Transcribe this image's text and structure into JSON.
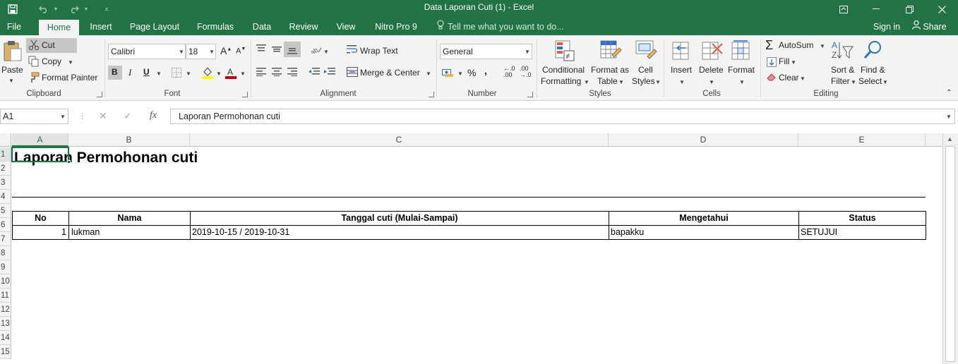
{
  "window": {
    "title": "Data Laporan Cuti (1) - Excel"
  },
  "tabs": [
    "File",
    "Home",
    "Insert",
    "Page Layout",
    "Formulas",
    "Data",
    "Review",
    "View",
    "Nitro Pro 9"
  ],
  "tell_me": "Tell me what you want to do...",
  "account": {
    "sign_in": "Sign in",
    "share": "Share"
  },
  "ribbon": {
    "clipboard": {
      "label": "Clipboard",
      "paste": "Paste",
      "cut": "Cut",
      "copy": "Copy",
      "format_painter": "Format Painter"
    },
    "font": {
      "label": "Font",
      "name": "Calibri",
      "size": "18",
      "bold": "B",
      "italic": "I",
      "underline": "U"
    },
    "alignment": {
      "label": "Alignment",
      "wrap_text": "Wrap Text",
      "merge_center": "Merge & Center"
    },
    "number": {
      "label": "Number",
      "format": "General",
      "percent": "%",
      "comma": ","
    },
    "styles": {
      "label": "Styles",
      "conditional_1": "Conditional",
      "conditional_2": "Formatting",
      "format_table_1": "Format as",
      "format_table_2": "Table",
      "cell_styles_1": "Cell",
      "cell_styles_2": "Styles"
    },
    "cells": {
      "label": "Cells",
      "insert": "Insert",
      "delete": "Delete",
      "format": "Format"
    },
    "editing": {
      "label": "Editing",
      "autosum": "AutoSum",
      "fill": "Fill",
      "clear": "Clear",
      "sort_1": "Sort &",
      "sort_2": "Filter",
      "find_1": "Find &",
      "find_2": "Select"
    }
  },
  "formula_bar": {
    "name_box": "A1",
    "fx": "fx",
    "value": "Laporan Permohonan cuti"
  },
  "sheet": {
    "columns": [
      "A",
      "B",
      "C",
      "D",
      "E"
    ],
    "rows": [
      "1",
      "2",
      "3",
      "4",
      "5",
      "6",
      "7",
      "8",
      "9",
      "10",
      "11",
      "12",
      "13",
      "14",
      "15"
    ],
    "title": "Laporan Permohonan cuti",
    "table": {
      "headers": [
        "No",
        "Nama",
        "Tanggal cuti (Mulai-Sampai)",
        "Mengetahui",
        "Status"
      ],
      "rows": [
        [
          "1",
          "lukman",
          "2019-10-15 / 2019-10-31",
          "bapakku",
          "SETUJUI"
        ]
      ]
    }
  }
}
